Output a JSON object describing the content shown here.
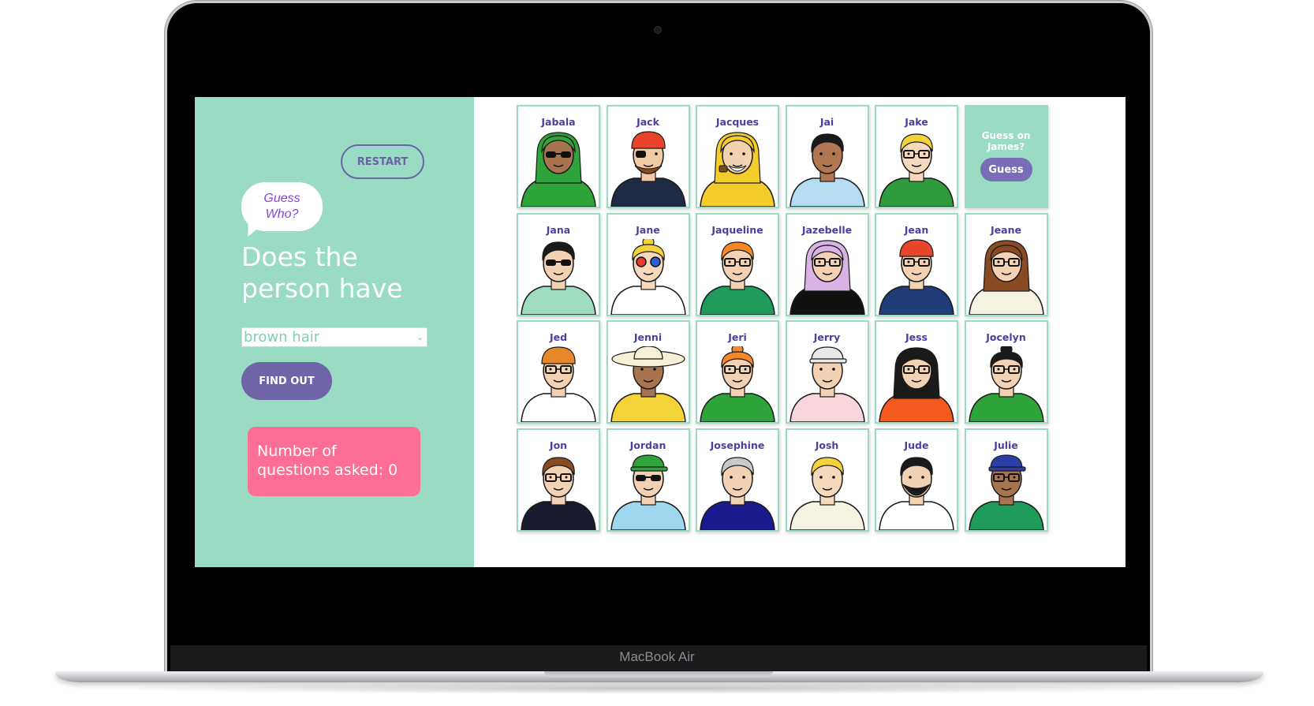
{
  "device": {
    "brand_label": "MacBook Air"
  },
  "sidebar": {
    "restart_label": "RESTART",
    "logo_line1": "Guess",
    "logo_line2": "Who?",
    "heading": "Does the person have",
    "select_value": "brown hair",
    "find_out_label": "FIND OUT",
    "counter_text": "Number of questions asked: 0"
  },
  "guess_panel": {
    "prompt": "Guess on James?",
    "button_label": "Guess"
  },
  "colors": {
    "mint": "#99dbc3",
    "purple": "#6f64a8",
    "pink": "#fc6e93",
    "name_text": "#4b3fa0"
  },
  "characters": [
    {
      "name": "Jabala",
      "skin": "#a8734f",
      "hair": "#2fa43a",
      "hair_style": "scarf",
      "shirt": "#2fa43a",
      "accessory": "sunglasses"
    },
    {
      "name": "Jack",
      "skin": "#f2cba4",
      "hair": "#e8452c",
      "hair_style": "bandana",
      "shirt": "#1f2a44",
      "accessory": "eyepatch"
    },
    {
      "name": "Jacques",
      "skin": "#f2d3b0",
      "hair": "#f4cd2b",
      "hair_style": "hood",
      "shirt": "#f4cd2b",
      "accessory": "pipe"
    },
    {
      "name": "Jai",
      "skin": "#b17752",
      "hair": "#1a1a1a",
      "hair_style": "short",
      "shirt": "#b5dcf2",
      "accessory": "none"
    },
    {
      "name": "Jake",
      "skin": "#f6d9bc",
      "hair": "#f4d33a",
      "hair_style": "short",
      "shirt": "#2f9b3c",
      "accessory": "glasses"
    },
    {
      "name": "Jana",
      "skin": "#f3d2b3",
      "hair": "#1a1a1a",
      "hair_style": "short",
      "shirt": "#9fdcc0",
      "accessory": "sunglasses"
    },
    {
      "name": "Jane",
      "skin": "#f6d9bc",
      "hair": "#f4d33a",
      "hair_style": "bun",
      "shirt": "#ffffff",
      "accessory": "colorglasses"
    },
    {
      "name": "Jaqueline",
      "skin": "#f3d2b3",
      "hair": "#f4872a",
      "hair_style": "short",
      "shirt": "#1e9b5a",
      "accessory": "glasses"
    },
    {
      "name": "Jazebelle",
      "skin": "#f3d2b3",
      "hair": "#d9b3e6",
      "hair_style": "long",
      "shirt": "#111111",
      "accessory": "glasses"
    },
    {
      "name": "Jean",
      "skin": "#f3d2b3",
      "hair": "#e8452c",
      "hair_style": "beanie",
      "shirt": "#1f3d78",
      "accessory": "glasses"
    },
    {
      "name": "Jeane",
      "skin": "#f3d2b3",
      "hair": "#8a4a22",
      "hair_style": "long",
      "shirt": "#f6f2e2",
      "accessory": "glasses"
    },
    {
      "name": "Jed",
      "skin": "#f3d2b3",
      "hair": "#e8872a",
      "hair_style": "beanie",
      "shirt": "#ffffff",
      "accessory": "glasses"
    },
    {
      "name": "Jenni",
      "skin": "#a8734f",
      "hair": "#f6f0d6",
      "hair_style": "hat",
      "shirt": "#f4d33a",
      "accessory": "none"
    },
    {
      "name": "Jeri",
      "skin": "#f3d2b3",
      "hair": "#f4872a",
      "hair_style": "bun",
      "shirt": "#2fa43a",
      "accessory": "glasses"
    },
    {
      "name": "Jerry",
      "skin": "#f3d2b3",
      "hair": "#e8e8e8",
      "hair_style": "cap",
      "shirt": "#f8d6dc",
      "accessory": "none"
    },
    {
      "name": "Jess",
      "skin": "#f3d2b3",
      "hair": "#1a1a1a",
      "hair_style": "long",
      "shirt": "#f45a1e",
      "accessory": "glasses"
    },
    {
      "name": "Jocelyn",
      "skin": "#f3d2b3",
      "hair": "#1a1a1a",
      "hair_style": "bun",
      "shirt": "#2fa43a",
      "accessory": "glasses"
    },
    {
      "name": "Jon",
      "skin": "#f3d2b3",
      "hair": "#8a4a22",
      "hair_style": "short",
      "shirt": "#1a1a2e",
      "accessory": "glasses"
    },
    {
      "name": "Jordan",
      "skin": "#f3d2b3",
      "hair": "#2fa43a",
      "hair_style": "cap",
      "shirt": "#9fd6f0",
      "accessory": "sunglasses"
    },
    {
      "name": "Josephine",
      "skin": "#f3d2b3",
      "hair": "#c9c9c9",
      "hair_style": "short",
      "shirt": "#1a1a8e",
      "accessory": "none"
    },
    {
      "name": "Josh",
      "skin": "#f6d9bc",
      "hair": "#f4d33a",
      "hair_style": "short",
      "shirt": "#f6f2e2",
      "accessory": "none"
    },
    {
      "name": "Jude",
      "skin": "#f3d2b3",
      "hair": "#1a1a1a",
      "hair_style": "short",
      "shirt": "#ffffff",
      "accessory": "beard"
    },
    {
      "name": "Julie",
      "skin": "#a8734f",
      "hair": "#2b3ea8",
      "hair_style": "cap",
      "shirt": "#1e9b5a",
      "accessory": "glasses"
    }
  ]
}
